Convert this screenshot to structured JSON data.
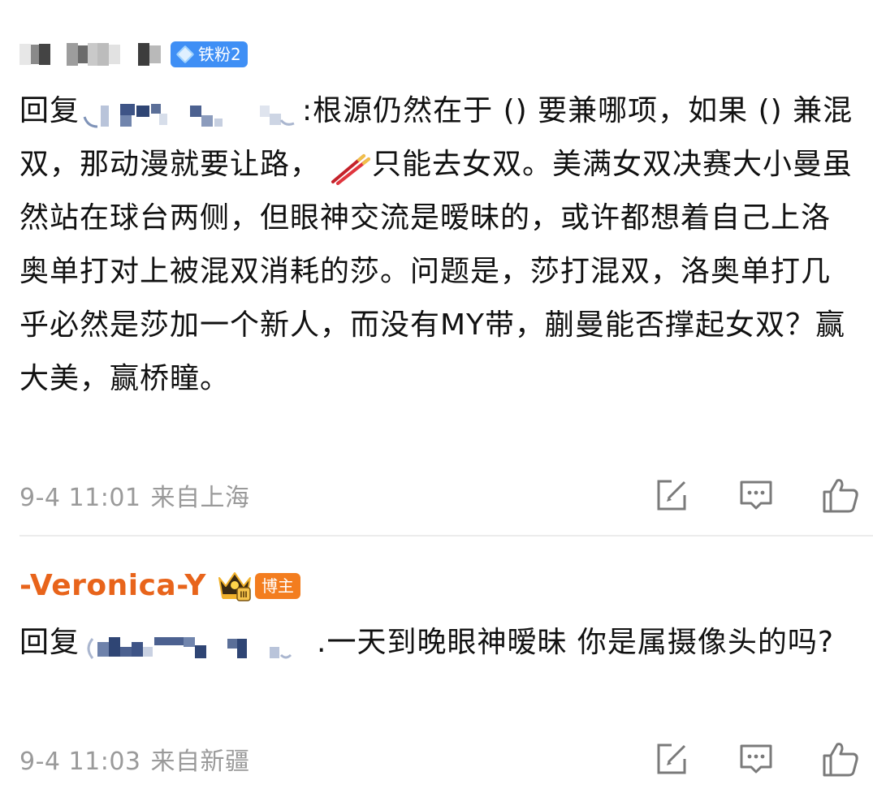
{
  "comments": [
    {
      "badge": "铁粉2",
      "reply_prefix": "回复",
      "text_after_name": ":根源仍然在于 () 要兼哪项，如果 () 兼混双，那动漫就要让路，",
      "text_after_emoji": "只能去女双。美满女双决赛大小曼虽然站在球台两侧，但眼神交流是暧昧的，或许都想着自己上洛奥单打对上被混双消耗的莎。问题是，莎打混双，洛奥单打几乎必然是莎加一个新人，而没有MY带，蒯曼能否撑起女双？赢大美，赢桥瞳。",
      "date": "9-4 11:01",
      "location": "来自上海",
      "emoji": "chopsticks-emoji"
    },
    {
      "username": "-Veronica-Y",
      "badge": "博主",
      "reply_prefix": "回复",
      "text_after_name": ".一天到晚眼神暧昧 你是属摄像头的吗?",
      "date": "9-4 11:03",
      "location": "来自新疆"
    }
  ],
  "icons": {
    "repost": "repost-icon",
    "comment": "comment-icon",
    "like": "like-icon",
    "badge_fan": "diamond-icon",
    "badge_blogger": "crown-icon"
  },
  "colors": {
    "fan_badge": "#3f8ff5",
    "blogger_name": "#e8641b",
    "blogger_badge": "#f37d1f",
    "meta_text": "#9a9a9a",
    "divider": "#ececec"
  }
}
